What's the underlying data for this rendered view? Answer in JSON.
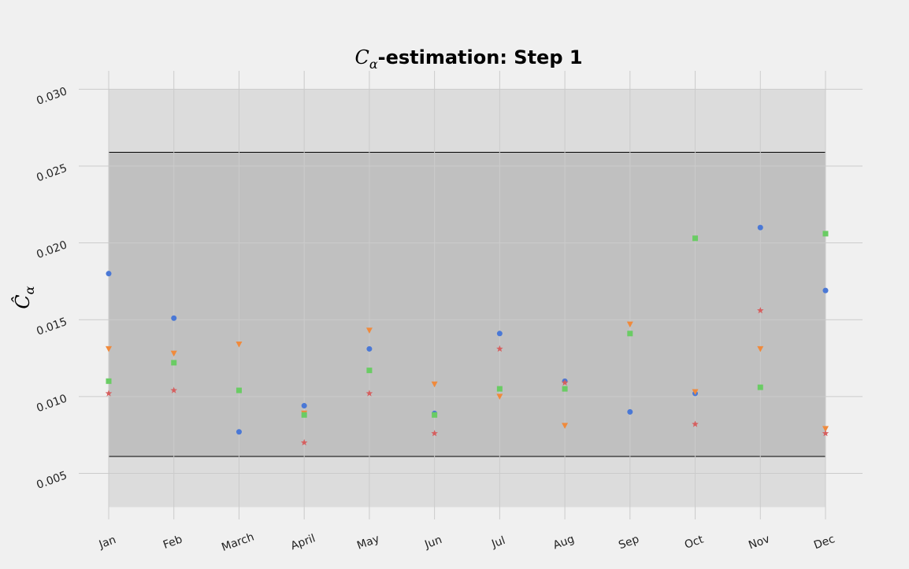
{
  "chart_data": {
    "type": "scatter",
    "title": {
      "symbol": "C",
      "subscript": "α",
      "text": "-estimation: Step 1"
    },
    "ylabel": {
      "symbol": "Ĉ",
      "subscript": "α"
    },
    "xlabel": "",
    "categories": [
      "Jan",
      "Feb",
      "March",
      "April",
      "May",
      "Jun",
      "Jul",
      "Aug",
      "Sep",
      "Oct",
      "Nov",
      "Dec"
    ],
    "ylim": [
      0.002,
      0.0312
    ],
    "yticks": [
      0.005,
      0.01,
      0.015,
      0.02,
      0.025,
      0.03
    ],
    "ytick_labels": [
      "0.005",
      "0.010",
      "0.015",
      "0.020",
      "0.025",
      "0.030"
    ],
    "outer_band": [
      0.0028,
      0.03
    ],
    "inner_band": [
      0.0061,
      0.0259
    ],
    "grid": true,
    "background": "#f0f0f0",
    "outer_band_color": "#dcdcdc",
    "inner_band_color": "#c0c0c0",
    "series": [
      {
        "marker": "circle",
        "color": "#4a78d6",
        "values": [
          0.018,
          0.0151,
          0.0077,
          0.0094,
          0.0131,
          0.0089,
          0.0141,
          0.011,
          0.009,
          0.0102,
          0.021,
          0.0169
        ]
      },
      {
        "marker": "triangle-down",
        "color": "#f08a3c",
        "values": [
          0.0131,
          0.0128,
          0.0134,
          0.0089,
          0.0143,
          0.0108,
          0.01,
          0.0081,
          0.0147,
          0.0103,
          0.0131,
          0.0079
        ]
      },
      {
        "marker": "square",
        "color": "#6acc64",
        "values": [
          0.011,
          0.0122,
          0.0104,
          0.0088,
          0.0117,
          0.0088,
          0.0105,
          0.0105,
          0.0141,
          0.0203,
          0.0106,
          0.0206
        ]
      },
      {
        "marker": "star",
        "color": "#d65f5f",
        "values": [
          0.0102,
          0.0104,
          null,
          0.007,
          0.0102,
          0.0076,
          0.0131,
          0.0109,
          null,
          0.0082,
          0.0156,
          0.0076
        ]
      }
    ]
  }
}
